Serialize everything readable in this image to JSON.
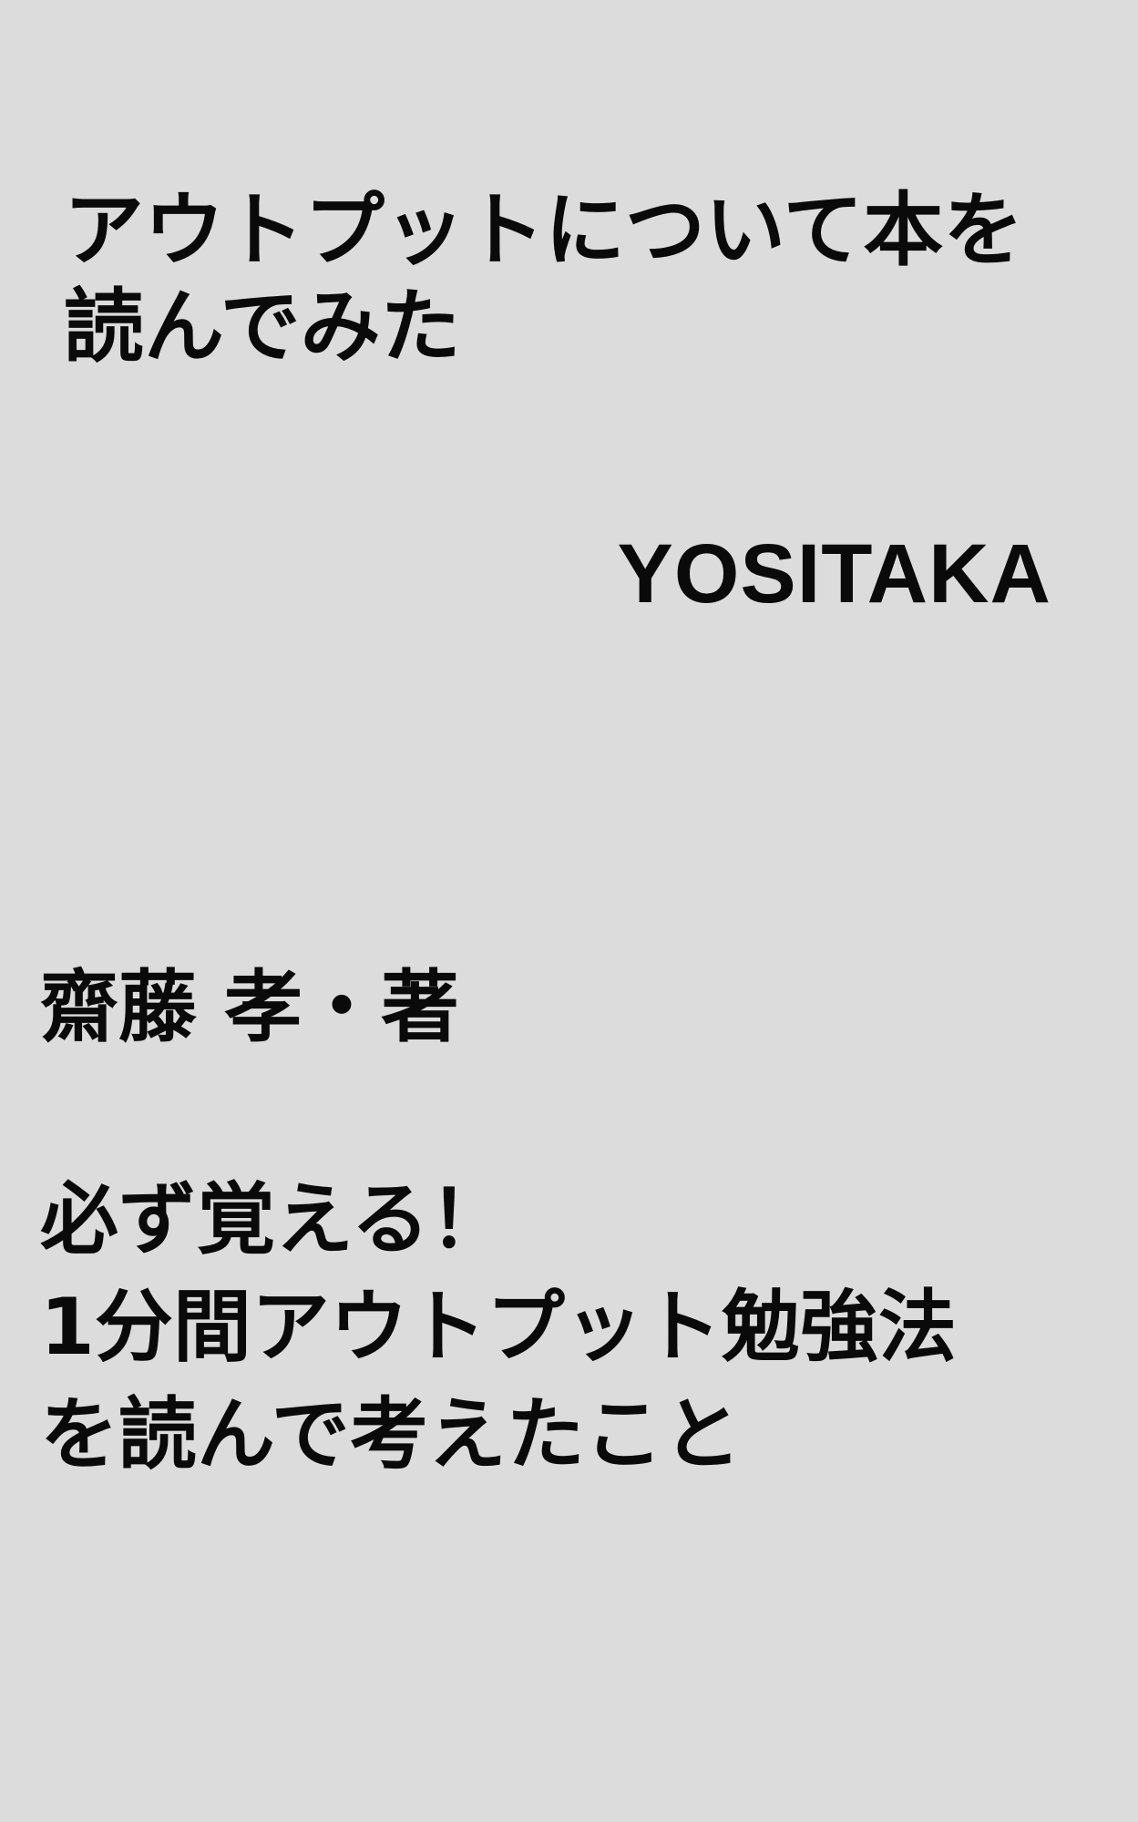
{
  "cover": {
    "title_lines": [
      "アウトプットについて本を",
      "読んでみた"
    ],
    "author": "YOSITAKA",
    "source_book_author": "齋藤 孝・著",
    "source_book_title_lines": [
      "必ず覚える！",
      "1分間アウトプット勉強法",
      "を読んで考えたこと"
    ],
    "background_color": "#dcdcdc",
    "text_color": "#0a0a0a"
  }
}
